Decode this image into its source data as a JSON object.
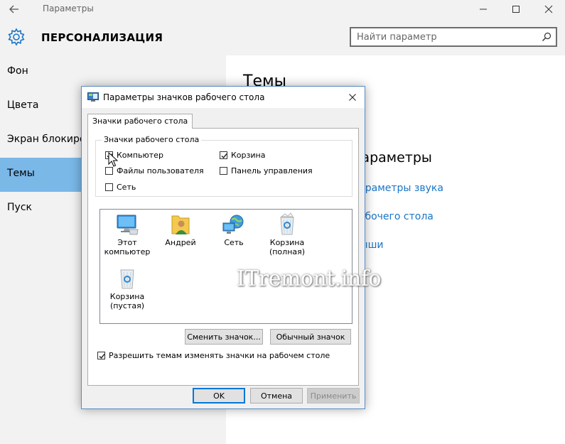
{
  "window": {
    "title": "Параметры",
    "section_title": "ПЕРСОНАЛИЗАЦИЯ",
    "search": {
      "placeholder": "Найти параметр"
    }
  },
  "sidebar": {
    "items": [
      {
        "label": "Фон",
        "active": false
      },
      {
        "label": "Цвета",
        "active": false
      },
      {
        "label": "Экран блокировки",
        "active": false
      },
      {
        "label": "Темы",
        "active": true
      },
      {
        "label": "Пуск",
        "active": false
      }
    ]
  },
  "content": {
    "heading": "Темы",
    "related_heading": "параметры",
    "links": [
      "параметры звука",
      "рабочего стола",
      "мыши"
    ]
  },
  "dialog": {
    "title": "Параметры значков рабочего стола",
    "tab": "Значки рабочего стола",
    "group_label": "Значки рабочего стола",
    "checkboxes": [
      {
        "label": "Компьютер",
        "checked": true
      },
      {
        "label": "Корзина",
        "checked": true
      },
      {
        "label": "Файлы пользователя",
        "checked": false
      },
      {
        "label": "Панель управления",
        "checked": false
      },
      {
        "label": "Сеть",
        "checked": false
      }
    ],
    "icons": [
      {
        "label": "Этот компьютер",
        "icon": "computer-icon",
        "selected": true
      },
      {
        "label": "Андрей",
        "icon": "user-folder-icon",
        "selected": false
      },
      {
        "label": "Сеть",
        "icon": "network-icon",
        "selected": false
      },
      {
        "label": "Корзина (полная)",
        "icon": "recycle-bin-full-icon",
        "selected": false
      },
      {
        "label": "Корзина (пустая)",
        "icon": "recycle-bin-empty-icon",
        "selected": false
      }
    ],
    "change_icon_button": "Сменить значок...",
    "restore_default_button": "Обычный значок",
    "allow_themes_checkbox": {
      "label": "Разрешить темам изменять значки на рабочем столе",
      "checked": true
    },
    "ok_button": "OK",
    "cancel_button": "Отмена",
    "apply_button": "Применить"
  },
  "watermark": "ITremont.info",
  "colors": {
    "accent": "#7ab8e8",
    "link": "#1a75c6",
    "dialog_border": "#5a8cc4"
  }
}
